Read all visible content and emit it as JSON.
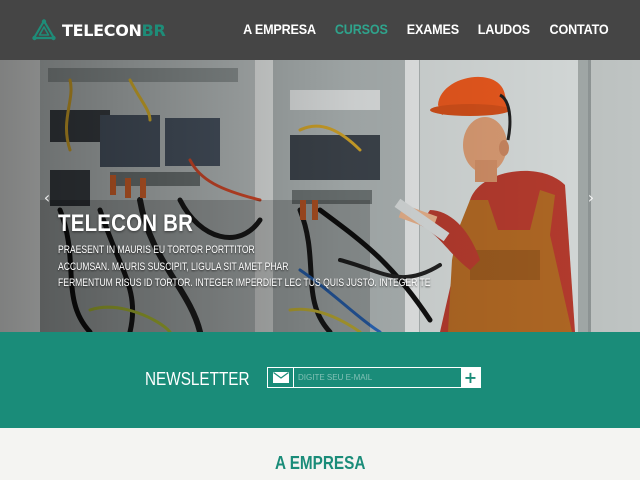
{
  "brand": {
    "name_main": "TELECON",
    "name_accent": "BR",
    "icon": "triangle-network-logo-icon"
  },
  "nav": {
    "items": [
      {
        "label": "A EMPRESA",
        "active": false
      },
      {
        "label": "CURSOS",
        "active": true
      },
      {
        "label": "EXAMES",
        "active": false
      },
      {
        "label": "LAUDOS",
        "active": false
      },
      {
        "label": "CONTATO",
        "active": false
      }
    ]
  },
  "hero": {
    "title": "TELECON BR",
    "lines": [
      "PRAESENT IN MAURIS EU TORTOR PORTTITOR",
      "ACCUMSAN. MAURIS SUSCIPIT, LIGULA SIT AMET PHAR",
      "FERMENTUM RISUS ID TORTOR. INTEGER IMPERDIET LEC TUS QUIS JUSTO. INTEGER TE"
    ],
    "prev_icon": "chevron-left-icon",
    "next_icon": "chevron-right-icon",
    "prev_glyph": "‹",
    "next_glyph": "›"
  },
  "newsletter": {
    "label": "NEWSLETTER",
    "placeholder": "DIGITE SEU E-MAIL",
    "submit_glyph": "+",
    "envelope_icon": "envelope-icon"
  },
  "about": {
    "title": "A EMPRESA"
  },
  "colors": {
    "header_bg": "#454545",
    "accent": "#1a8c79",
    "nav_active": "#2fa38c",
    "page_bg": "#f4f4f2"
  }
}
